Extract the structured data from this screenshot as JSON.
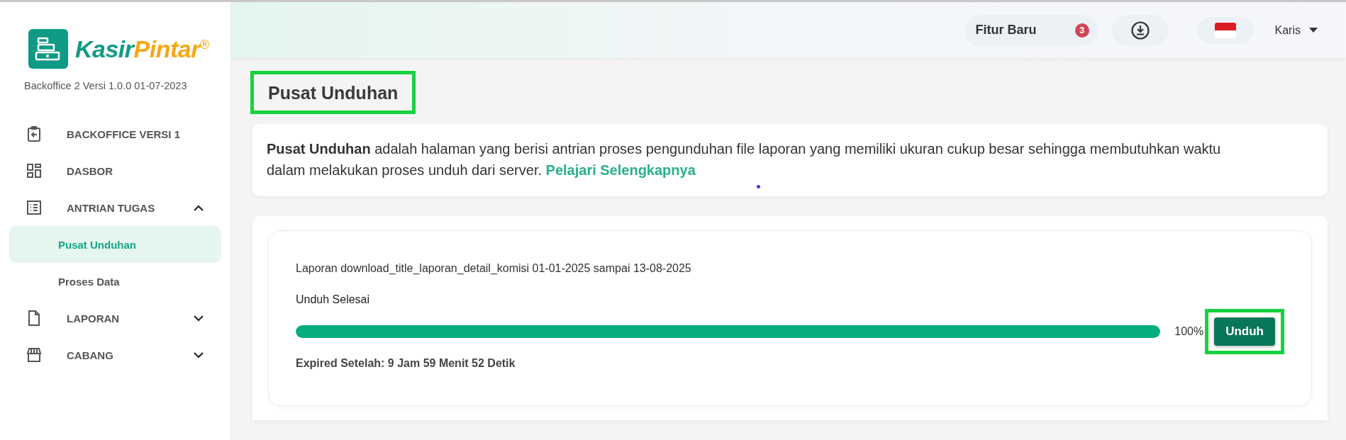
{
  "logo": {
    "brand_first": "Kasir",
    "brand_second": "Pintar",
    "trademark": "®"
  },
  "version": "Backoffice 2 Versi 1.0.0 01-07-2023",
  "sidebar": {
    "items": [
      {
        "label": "BACKOFFICE VERSI 1"
      },
      {
        "label": "DASBOR"
      },
      {
        "label": "ANTRIAN TUGAS",
        "expanded": true,
        "children": [
          {
            "label": "Pusat Unduhan",
            "selected": true
          },
          {
            "label": "Proses Data",
            "selected": false
          }
        ]
      },
      {
        "label": "LAPORAN",
        "expanded": false
      },
      {
        "label": "CABANG",
        "expanded": false
      }
    ]
  },
  "header": {
    "new_features": {
      "label": "Fitur Baru",
      "count": "3"
    },
    "user": "Karis"
  },
  "page_title": {
    "text": "Pusat Unduhan",
    "highlighted": true
  },
  "info": {
    "text": "**Pusat Unduhan** adalah halaman yang berisi antrian proses pengunduhan file laporan yang memiliki ukuran cukup besar sehingga membutuhkan waktu dalam melakukan proses unduh dari server.",
    "link": "Pelajari Selengkapnya"
  },
  "downloads": [
    {
      "title": "Laporan download_title_laporan_detail_komisi 01-01-2025 sampai 13-08-2025",
      "status": "Unduh Selesai",
      "level": 1,
      "percent": "100%",
      "button": {
        "label": "Unduh",
        "highlighted": true
      },
      "expiry": "Expired Setelah: 9 Jam 59 Menit 52 Detik"
    }
  ]
}
